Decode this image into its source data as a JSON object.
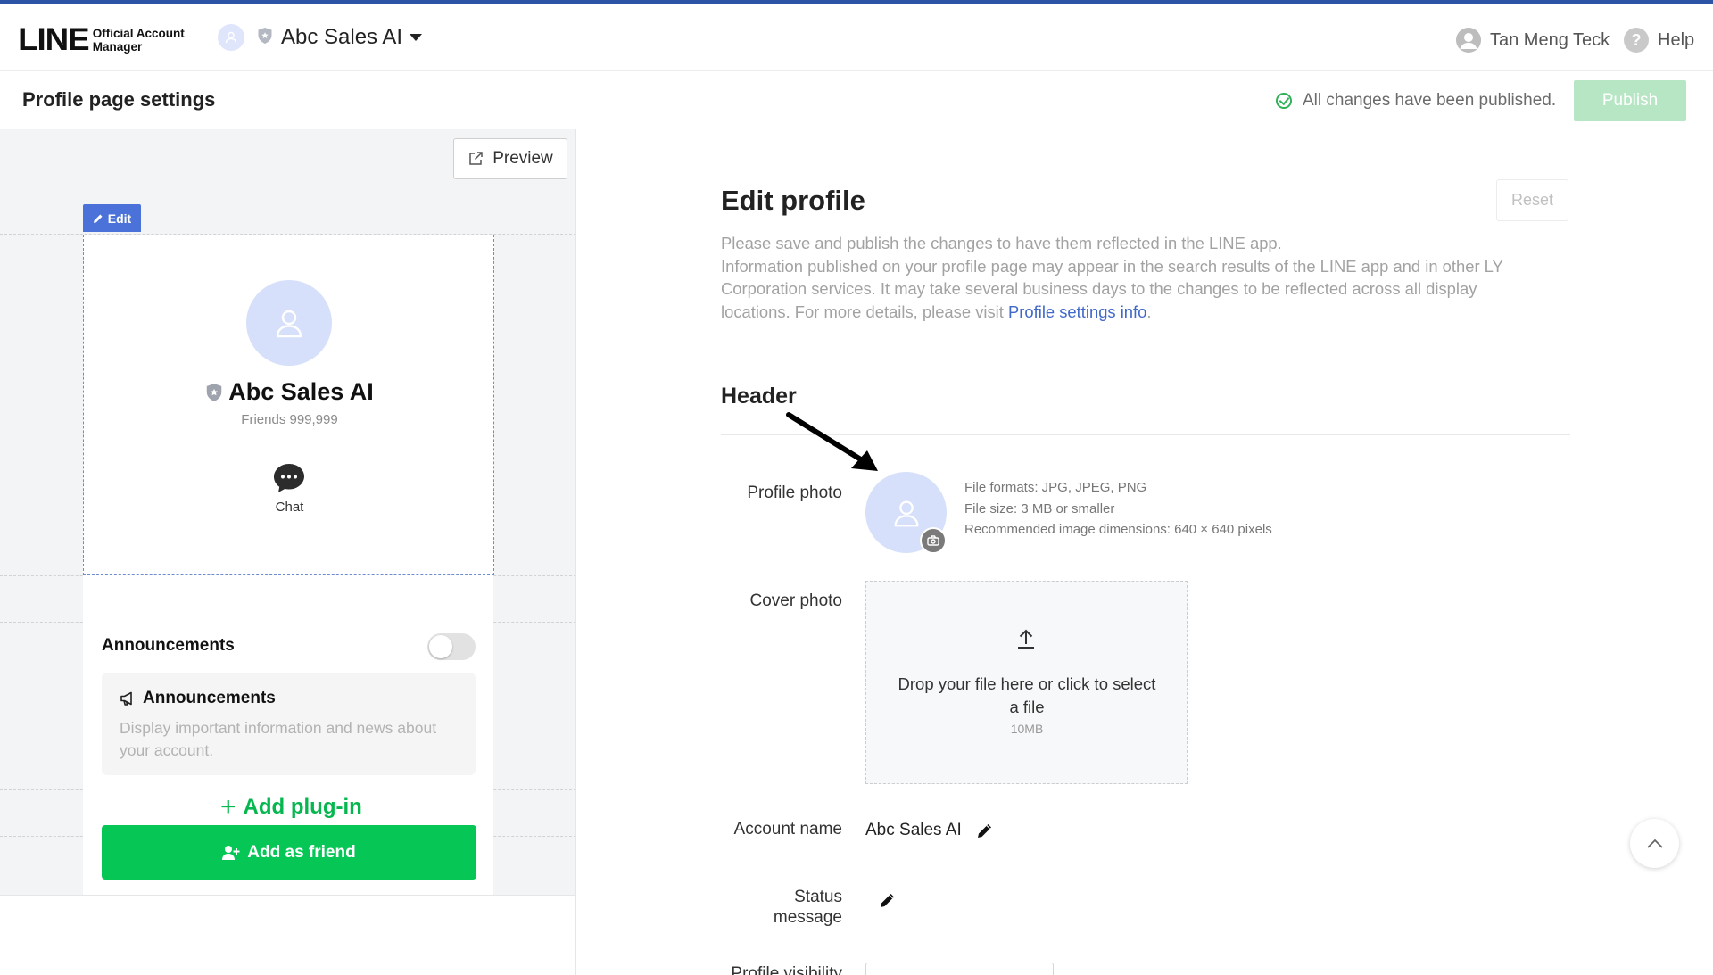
{
  "app": {
    "logo_main": "LINE",
    "logo_sub_1": "Official Account",
    "logo_sub_2": "Manager",
    "account_name": "Abc Sales AI",
    "user_name": "Tan Meng Teck",
    "help_label": "Help"
  },
  "pagebar": {
    "title": "Profile page settings",
    "status_text": "All changes have been published.",
    "publish_label": "Publish"
  },
  "preview": {
    "preview_label": "Preview",
    "edit_tag": "Edit",
    "account_name": "Abc Sales AI",
    "friends": "Friends 999,999",
    "chat_label": "Chat",
    "announcements_header": "Announcements",
    "announcements_toggle_on": false,
    "announcements_card_title": "Announcements",
    "announcements_card_desc": "Display important information and news about your account.",
    "add_friend_label": "Add as friend",
    "add_plugin_label": "Add plug-in"
  },
  "editor": {
    "heading": "Edit profile",
    "reset_label": "Reset",
    "intro_line1": "Please save and publish the changes to have them reflected in the LINE app.",
    "intro_line2": "Information published on your profile page may appear in the search results of the LINE app and in other LY Corporation services. It may take several business days to the changes to be reflected across all display locations. For more details, please visit",
    "intro_link": "Profile settings info",
    "intro_end": ".",
    "section_header": "Header",
    "profile_photo_label": "Profile photo",
    "profile_photo_info": [
      "File formats: JPG, JPEG, PNG",
      "File size: 3 MB or smaller",
      "Recommended image dimensions: 640 × 640 pixels"
    ],
    "cover_photo_label": "Cover photo",
    "dropzone_text": "Drop your file here or click to select a file",
    "dropzone_size": "10MB",
    "account_name_label": "Account name",
    "account_name_value": "Abc Sales AI",
    "status_message_label_1": "Status",
    "status_message_label_2": "message",
    "profile_visibility_label": "Profile visibility"
  },
  "colors": {
    "brand_green": "#06c755",
    "accent_blue": "#4a72d8",
    "link_blue": "#3f68c9",
    "top_line": "#2e54a6"
  },
  "icons": [
    "user-avatar-icon",
    "shield-icon",
    "caret-down-icon",
    "help-icon",
    "check-circle-icon",
    "external-link-icon",
    "pencil-icon",
    "chat-bubble-icon",
    "megaphone-icon",
    "add-user-icon",
    "plus-icon",
    "camera-icon",
    "upload-icon",
    "chevron-up-icon",
    "arrow-annotation"
  ]
}
